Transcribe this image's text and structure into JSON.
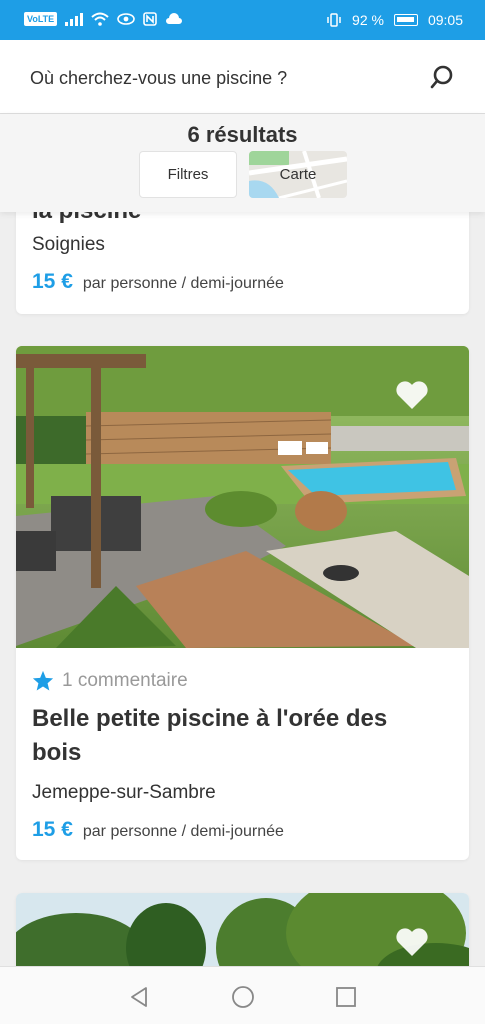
{
  "status": {
    "network": "VoLTE",
    "battery": "92 %",
    "time": "09:05"
  },
  "search": {
    "placeholder": "Où cherchez-vous une piscine ?",
    "icon": "search-icon"
  },
  "results": {
    "count_label": "6 résultats",
    "filters_label": "Filtres",
    "map_label": "Carte"
  },
  "listings": [
    {
      "title": "la piscine",
      "city": "Soignies",
      "price": "15 €",
      "price_unit": "par personne / demi-journée"
    },
    {
      "reviews": "1 commentaire",
      "title": "Belle petite piscine à l'orée des bois",
      "city": "Jemeppe-sur-Sambre",
      "price": "15 €",
      "price_unit": "par personne / demi-journée"
    }
  ],
  "colors": {
    "accent": "#1e9ee6",
    "statusbar": "#1e9ee6"
  },
  "nav": {
    "back": "back-icon",
    "home": "home-icon",
    "recents": "recents-icon"
  }
}
